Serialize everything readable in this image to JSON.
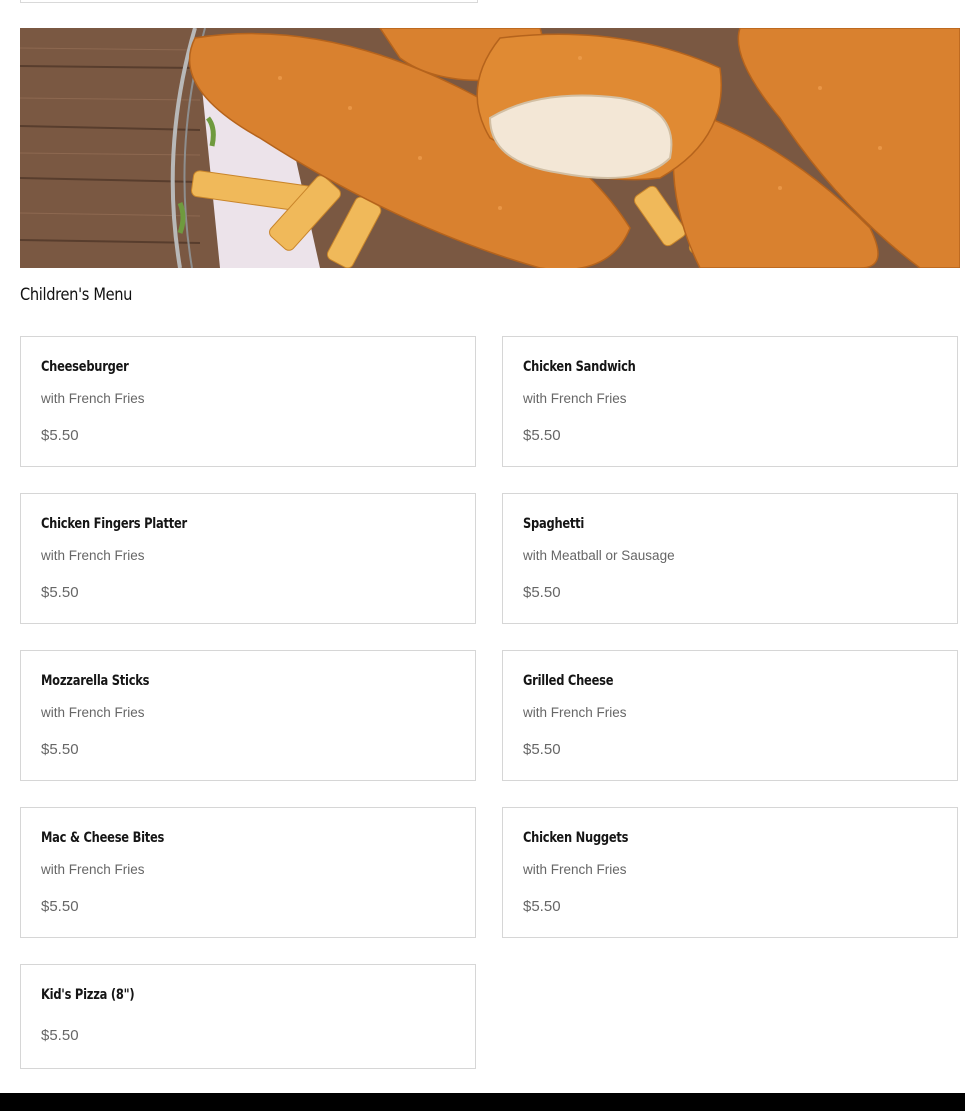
{
  "section": {
    "title": "Children's Menu"
  },
  "hero": {
    "image_label": "chicken-fingers-and-fries"
  },
  "items": [
    {
      "name": "Cheeseburger",
      "description": "with French Fries",
      "price": "$5.50"
    },
    {
      "name": "Chicken Sandwich",
      "description": "with French Fries",
      "price": "$5.50"
    },
    {
      "name": "Chicken Fingers Platter",
      "description": "with French Fries",
      "price": "$5.50"
    },
    {
      "name": "Spaghetti",
      "description": "with Meatball or Sausage",
      "price": "$5.50"
    },
    {
      "name": "Mozzarella Sticks",
      "description": "with French Fries",
      "price": "$5.50"
    },
    {
      "name": "Grilled Cheese",
      "description": "with French Fries",
      "price": "$5.50"
    },
    {
      "name": "Mac & Cheese Bites",
      "description": "with French Fries",
      "price": "$5.50"
    },
    {
      "name": "Chicken Nuggets",
      "description": "with French Fries",
      "price": "$5.50"
    },
    {
      "name": "Kid's Pizza (8\")",
      "price": "$5.50"
    }
  ],
  "colors": {
    "card_border": "#d6d6d6",
    "text_muted": "#666666",
    "footer": "#000000"
  }
}
